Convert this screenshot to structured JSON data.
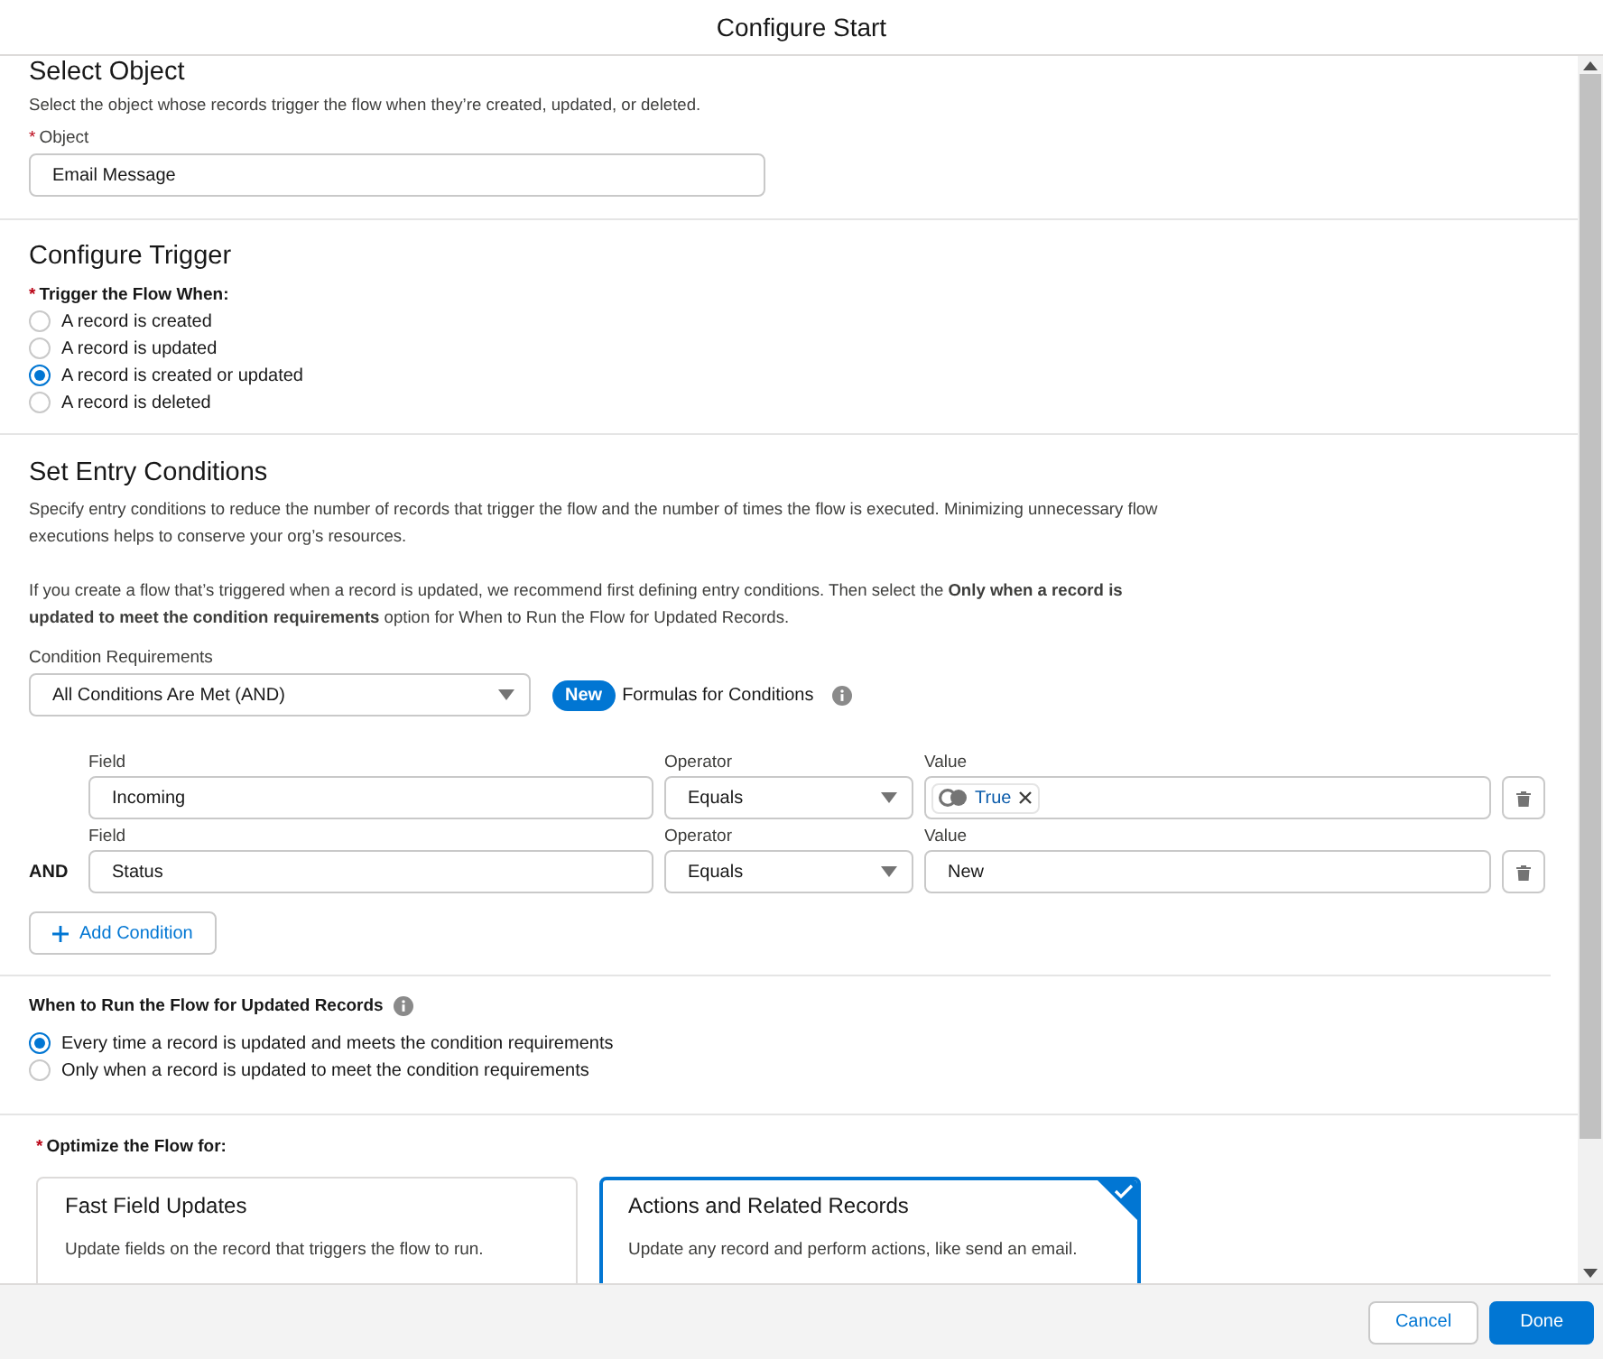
{
  "window": {
    "title": "Configure Start"
  },
  "select_object": {
    "heading": "Select Object",
    "description": "Select the object whose records trigger the flow when they’re created, updated, or deleted.",
    "object_field": {
      "required_mark": "*",
      "label": "Object",
      "value": "Email Message"
    }
  },
  "configure_trigger": {
    "heading": "Configure Trigger",
    "required_mark": "*",
    "label": "Trigger the Flow When:",
    "options": [
      {
        "label": "A record is created",
        "selected": false
      },
      {
        "label": "A record is updated",
        "selected": false
      },
      {
        "label": "A record is created or updated",
        "selected": true
      },
      {
        "label": "A record is deleted",
        "selected": false
      }
    ]
  },
  "entry_conditions": {
    "heading": "Set Entry Conditions",
    "description": "Specify entry conditions to reduce the number of records that trigger the flow and the number of times the flow is executed. Minimizing unnecessary flow executions helps to conserve your org’s resources.",
    "note": "If you create a flow that’s triggered when a record is updated, we recommend first defining entry conditions. Then select the **Only when a record is updated to meet the condition requirements** option for When to Run the Flow for Updated Records.",
    "requirements": {
      "label": "Condition Requirements",
      "value": "All Conditions Are Met (AND)"
    },
    "new_badge": "New",
    "formulas_label": "Formulas for Conditions",
    "conditions": [
      {
        "field_label": "Field",
        "field": "Incoming",
        "operator_label": "Operator",
        "operator": "Equals",
        "value_label": "Value",
        "value": {
          "kind": "pill",
          "text": "True"
        }
      },
      {
        "connector": "AND",
        "field_label": "Field",
        "field": "Status",
        "operator_label": "Operator",
        "operator": "Equals",
        "value_label": "Value",
        "value": {
          "kind": "text",
          "text": "New"
        }
      }
    ],
    "add_condition": "Add Condition"
  },
  "run_when": {
    "label": "When to Run the Flow for Updated Records",
    "options": [
      {
        "label": "Every time a record is updated and meets the condition requirements",
        "selected": true
      },
      {
        "label": "Only when a record is updated to meet the condition requirements",
        "selected": false
      }
    ]
  },
  "optimize": {
    "required_mark": "*",
    "label": "Optimize the Flow for:",
    "cards": [
      {
        "title": "Fast Field Updates",
        "description": "Update fields on the record that triggers the flow to run.",
        "selected": false
      },
      {
        "title": "Actions and Related Records",
        "description": "Update any record and perform actions, like send an email.",
        "selected": true
      }
    ]
  },
  "footer": {
    "buttons": [
      {
        "label": "Cancel",
        "kind": "neutral"
      },
      {
        "label": "Done",
        "kind": "brand"
      }
    ]
  }
}
